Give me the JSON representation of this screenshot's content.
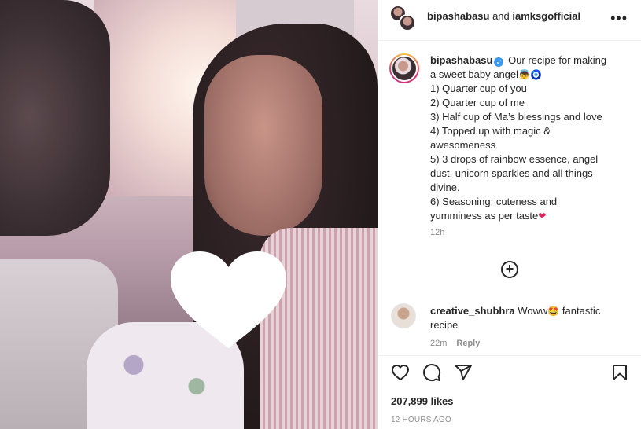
{
  "header": {
    "username": "bipashabasu",
    "connector": " and ",
    "collaborator": "iamksgofficial"
  },
  "caption": {
    "username": "bipashabasu",
    "lines": [
      "Our recipe for making",
      "a sweet baby angel",
      "1) Quarter cup of you",
      "2) Quarter cup of me",
      "3) Half cup of Ma’s blessings and love",
      "4) Topped up with magic &",
      "awesomeness",
      "5) 3 drops of rainbow essence, angel",
      "dust, unicorn sparkles and all things",
      "divine.",
      "6) Seasoning: cuteness and",
      "yumminess as per taste"
    ],
    "time": "12h",
    "emojis": {
      "angel": "👼",
      "evil_eye": "🧿",
      "heart": "❤"
    }
  },
  "comment": {
    "username": "creative_shubhra",
    "text_before": "Woww",
    "emoji": "🤩",
    "text_after": " fantastic recipe",
    "time": "22m",
    "reply": "Reply"
  },
  "actions": {
    "likes": "207,899 likes",
    "posted": "12 HOURS AGO"
  }
}
